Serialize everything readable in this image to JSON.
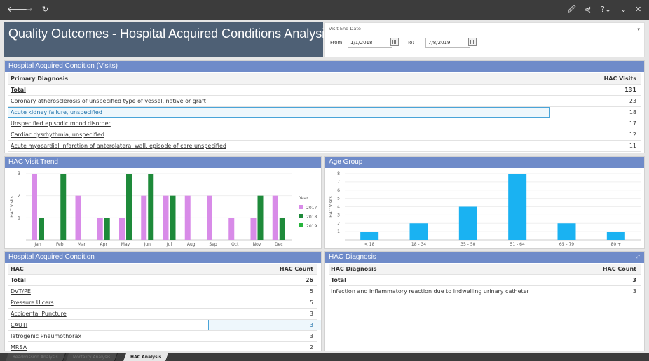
{
  "toolbar": {
    "back_icon": "arrow-left-icon",
    "forward_icon": "arrow-right-icon",
    "refresh_icon": "refresh-icon",
    "icons_right": [
      "edit-icon",
      "share-icon",
      "help-icon",
      "collapse-icon",
      "close-icon"
    ],
    "help_label": "?",
    "back_glyph": "🡐",
    "forward_glyph": "→",
    "refresh_glyph": "↻",
    "edit_glyph": "🖉",
    "share_glyph": "⋞",
    "help_glyph": "?⌄",
    "collapse_glyph": "⌄",
    "close_glyph": "✕"
  },
  "title": "Quality Outcomes - Hospital Acquired Conditions Analysis",
  "date_filter": {
    "label": "Visit End Date",
    "from_label": "From:",
    "from_value": "1/1/2018",
    "to_label": "To:",
    "to_value": "7/8/2019",
    "dropdown_glyph": "▾"
  },
  "visits_panel": {
    "header": "Hospital Acquired Condition (Visits)",
    "col_diag": "Primary Diagnosis",
    "col_visits": "HAC Visits",
    "total_label": "Total",
    "total_value": "131",
    "rows": [
      {
        "label": "Coronary atherosclerosis of unspecified type of vessel, native or graft",
        "value": "23"
      },
      {
        "label": "Acute kidney failure, unspecified",
        "value": "18"
      },
      {
        "label": "Unspecified episodic mood disorder",
        "value": "17"
      },
      {
        "label": "Cardiac dysrhythmia, unspecified",
        "value": "12"
      },
      {
        "label": "Acute myocardial infarction of anterolateral wall, episode of care unspecified",
        "value": "11"
      }
    ]
  },
  "trend_panel": {
    "header": "HAC Visit Trend"
  },
  "age_panel": {
    "header": "Age Group"
  },
  "hac_panel": {
    "header": "Hospital Acquired Condition",
    "col_hac": "HAC",
    "col_count": "HAC Count",
    "total_label": "Total",
    "total_value": "26",
    "rows": [
      {
        "label": "DVT/PE",
        "value": "5"
      },
      {
        "label": "Pressure Ulcers",
        "value": "5"
      },
      {
        "label": "Accidental Puncture",
        "value": "3"
      },
      {
        "label": "CAUTI",
        "value": "3"
      },
      {
        "label": "Iatrogenic Pneumothorax",
        "value": "3"
      },
      {
        "label": "MRSA",
        "value": "2"
      }
    ]
  },
  "diag_panel": {
    "header": "HAC Diagnosis",
    "col_diag": "HAC Diagnosis",
    "col_count": "HAC Count",
    "total_label": "Total",
    "total_value": "3",
    "rows": [
      {
        "label": "Infection and inflammatory reaction due to indwelling urinary catheter",
        "value": "3"
      }
    ]
  },
  "tabs": [
    {
      "label": "Readmission Analysis",
      "active": false
    },
    {
      "label": "Mortality Analysis",
      "active": false
    },
    {
      "label": "HAC Analysis",
      "active": true
    }
  ],
  "colors": {
    "accent": "#6f8bc9",
    "c2017": "#d88be8",
    "c2018": "#1e8a3a",
    "c2019": "#27b43c",
    "age": "#1ab2f2"
  },
  "chart_data": [
    {
      "type": "bar",
      "title": "HAC Visit Trend",
      "ylabel": "HAC Visits",
      "ylim": [
        0,
        3
      ],
      "yticks": [
        1,
        2,
        3
      ],
      "legend_title": "Year",
      "legend_position": "right",
      "categories": [
        "Jan",
        "Feb",
        "Mar",
        "Apr",
        "May",
        "Jun",
        "Jul",
        "Aug",
        "Sep",
        "Oct",
        "Nov",
        "Dec"
      ],
      "series": [
        {
          "name": "2017",
          "color": "#d88be8",
          "values": [
            3,
            0,
            2,
            1,
            1,
            2,
            2,
            2,
            2,
            1,
            1,
            2
          ]
        },
        {
          "name": "2018",
          "color": "#1e8a3a",
          "values": [
            1,
            3,
            0,
            1,
            3,
            3,
            2,
            0,
            0,
            0,
            2,
            1
          ]
        },
        {
          "name": "2019",
          "color": "#27b43c",
          "values": [
            0,
            0,
            0,
            0,
            0,
            0,
            0,
            0,
            0,
            0,
            0,
            0
          ]
        }
      ]
    },
    {
      "type": "bar",
      "title": "Age Group",
      "ylabel": "HAC Visits",
      "ylim": [
        0,
        8
      ],
      "yticks": [
        1,
        2,
        3,
        4,
        5,
        6,
        7,
        8
      ],
      "categories": [
        "< 18",
        "18 - 34",
        "35 - 50",
        "51 - 64",
        "65 - 79",
        "80 +"
      ],
      "values": [
        1,
        2,
        4,
        8,
        2,
        1
      ],
      "color": "#1ab2f2"
    }
  ]
}
